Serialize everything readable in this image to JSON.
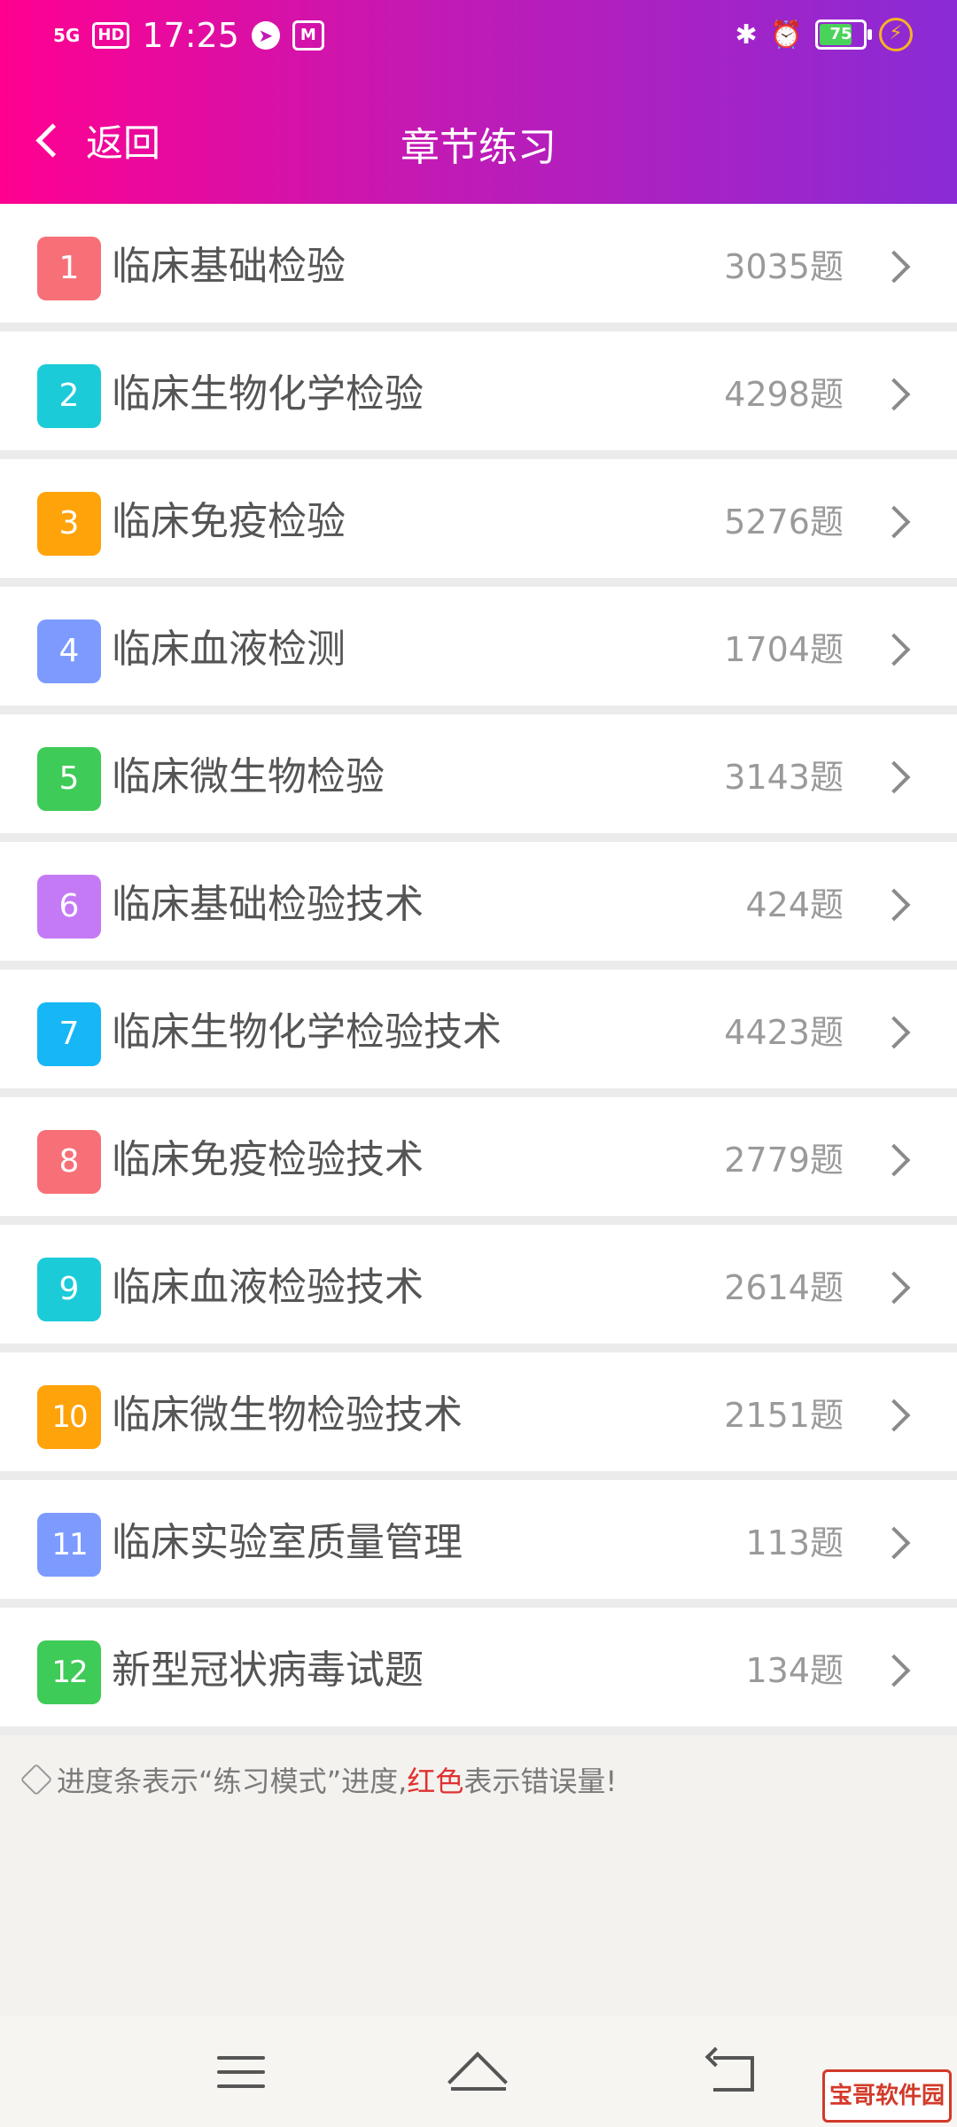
{
  "status_bar": {
    "network": "5G",
    "hd": "HD",
    "time": "17:25",
    "battery_level": "75",
    "icons": [
      "signal-icon",
      "hd-icon",
      "compass-icon",
      "app-icon",
      "bluetooth-icon",
      "alarm-icon",
      "battery-icon",
      "charging-icon"
    ]
  },
  "nav": {
    "back_label": "返回",
    "title": "章节练习"
  },
  "chapters": [
    {
      "num": "1",
      "title": "临床基础检验",
      "count": "3035题",
      "color": "#f77077"
    },
    {
      "num": "2",
      "title": "临床生物化学检验",
      "count": "4298题",
      "color": "#1ccbd8"
    },
    {
      "num": "3",
      "title": "临床免疫检验",
      "count": "5276题",
      "color": "#ffa30a"
    },
    {
      "num": "4",
      "title": "临床血液检测",
      "count": "1704题",
      "color": "#7d9bff"
    },
    {
      "num": "5",
      "title": "临床微生物检验",
      "count": "3143题",
      "color": "#3fcb58"
    },
    {
      "num": "6",
      "title": "临床基础检验技术",
      "count": "424题",
      "color": "#c57af5"
    },
    {
      "num": "7",
      "title": "临床生物化学检验技术",
      "count": "4423题",
      "color": "#17b7f5"
    },
    {
      "num": "8",
      "title": "临床免疫检验技术",
      "count": "2779题",
      "color": "#f77077"
    },
    {
      "num": "9",
      "title": "临床血液检验技术",
      "count": "2614题",
      "color": "#1ccbd8"
    },
    {
      "num": "10",
      "title": "临床微生物检验技术",
      "count": "2151题",
      "color": "#ffa30a"
    },
    {
      "num": "11",
      "title": "临床实验室质量管理",
      "count": "113题",
      "color": "#7d9bff"
    },
    {
      "num": "12",
      "title": "新型冠状病毒试题",
      "count": "134题",
      "color": "#3fcb58"
    }
  ],
  "note": {
    "prefix": "进度条表示“练习模式”进度,",
    "red": "红色",
    "suffix": "表示错误量!"
  },
  "watermark": "宝哥软件园",
  "colors": {
    "header_start": "#ff0090",
    "header_end": "#8a2bd6",
    "error_red": "#e03131"
  }
}
